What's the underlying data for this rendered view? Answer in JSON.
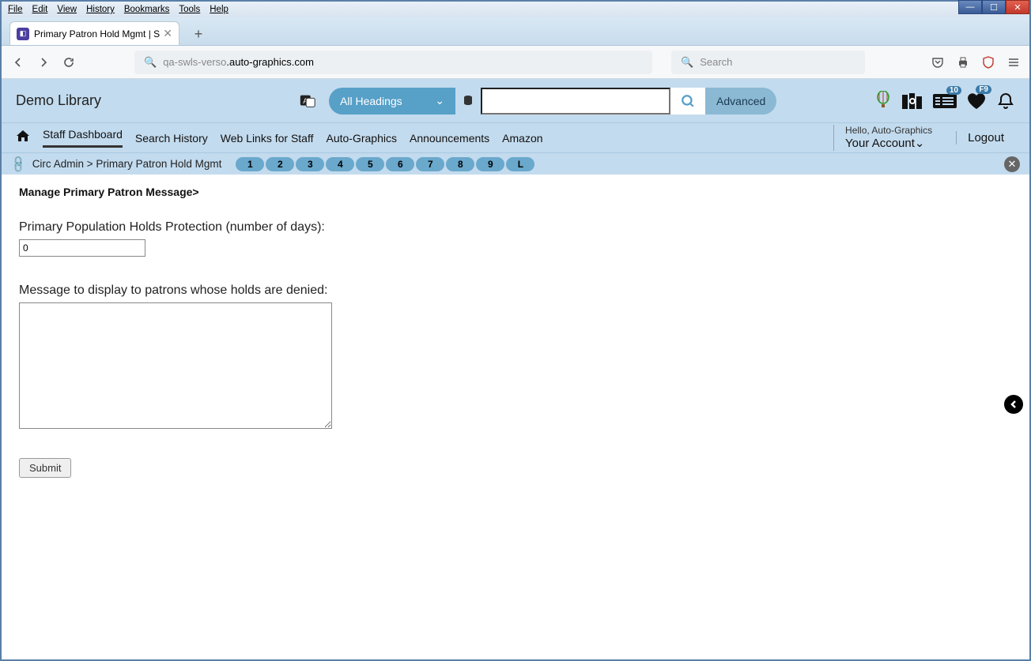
{
  "menubar": [
    "File",
    "Edit",
    "View",
    "History",
    "Bookmarks",
    "Tools",
    "Help"
  ],
  "tab": {
    "title": "Primary Patron Hold Mgmt | SW"
  },
  "address": {
    "prefix": "qa-swls-verso",
    "suffix": ".auto-graphics.com"
  },
  "browser_search_placeholder": "Search",
  "library": {
    "name": "Demo Library",
    "headings_label": "All Headings",
    "advanced_label": "Advanced",
    "badge_list": "10",
    "badge_fav": "F9"
  },
  "nav": {
    "items": [
      "Staff Dashboard",
      "Search History",
      "Web Links for Staff",
      "Auto-Graphics",
      "Announcements",
      "Amazon"
    ],
    "hello": "Hello, Auto-Graphics",
    "account": "Your Account",
    "logout": "Logout"
  },
  "crumb": {
    "text": "Circ Admin  >  Primary Patron Hold Mgmt",
    "pills": [
      "1",
      "2",
      "3",
      "4",
      "5",
      "6",
      "7",
      "8",
      "9",
      "L"
    ]
  },
  "page": {
    "heading": "Manage Primary Patron Message>",
    "days_label": "Primary Population Holds Protection (number of days):",
    "days_value": "0",
    "msg_label": "Message to display to patrons whose holds are denied:",
    "msg_value": "",
    "submit": "Submit"
  }
}
